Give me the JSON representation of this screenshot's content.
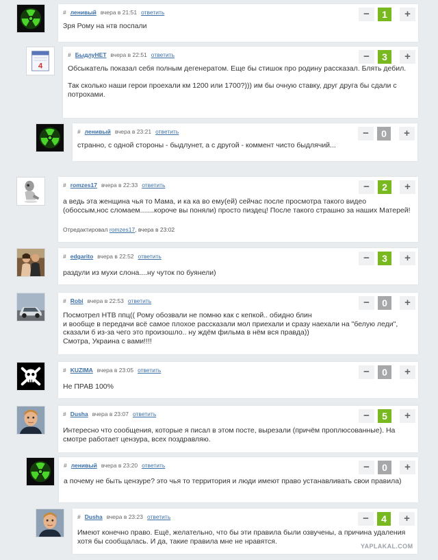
{
  "comments": [
    {
      "user": "ленивый",
      "time": "вчера в 21:51",
      "reply": "ответить",
      "score": "1",
      "text": "Зря Рому на нтв поспали",
      "avatar": "radiation-icon"
    },
    {
      "user": "БыдлуНЕТ",
      "time": "вчера в 22:51",
      "reply": "ответить",
      "score": "3",
      "text": "Обсыкатель показал себя полным дегенератом. Еще бы стишок про родину рассказал. Блять дебил.\n\nТак сколько наши герои проехали км 1200 или 1700?))) им бы очную ставку, друг друга бы сдали с потрохами.",
      "avatar": "calendar-icon"
    },
    {
      "user": "ленивый",
      "time": "вчера в 23:21",
      "reply": "ответить",
      "score": "0",
      "text": "странно, с одной стороны - быдлунет, а с другой - коммент чисто быдлячий...",
      "avatar": "radiation-icon"
    },
    {
      "user": "romzes17",
      "time": "вчера в 22:33",
      "reply": "ответить",
      "score": "2",
      "text": "а ведь эта женщина чья то Мама, и ка ка во ему(ей) сейчас после просмотра такого видео (обоссым,нос сломаем.......короче вы поняли) просто пиздец! После такого страшно за наших Матерей!",
      "edited_label": "Отредактировал",
      "edited_user": "romzes17",
      "edited_time": ", вчера в 23:02",
      "avatar": "figure-icon"
    },
    {
      "user": "edgarito",
      "time": "вчера в 22:52",
      "reply": "ответить",
      "score": "3",
      "text": "раздули из мухи слона....ну чуток по буянели)",
      "avatar": "photo-people-icon"
    },
    {
      "user": "Robi",
      "time": "вчера в 22:53",
      "reply": "ответить",
      "score": "0",
      "text": "Посмотрел НТВ ппц(( Рому обозвали не помню как с кепкой.. обидно блин\nи вообще в передачи всё самое плохое рассказали мол приехали и сразу наехали на \"белую леди\", сказали б из-за чего это произошло.. ну ждём фильма в нём вся правда))\nСмотра, Украина с вами!!!!",
      "avatar": "car-icon"
    },
    {
      "user": "KUZIMA",
      "time": "вчера в 23:05",
      "reply": "ответить",
      "score": "0",
      "text": "Не ПРАВ 100%",
      "avatar": "skull-icon"
    },
    {
      "user": "Dusha",
      "time": "вчера в 23:07",
      "reply": "ответить",
      "score": "5",
      "text": "Интересно что сообщения, которые я писал в этом посте, вырезали (причём проплюсованные). На смотре работает цензура, всех поздравляю.",
      "avatar": "face-icon"
    },
    {
      "user": "ленивый",
      "time": "вчера в 23:20",
      "reply": "ответить",
      "score": "0",
      "text": "а почему не быть цензуре? это чья то территория и люди имеют право устанавливать свои правила)",
      "avatar": "radiation-icon"
    },
    {
      "user": "Dusha",
      "time": "вчера в 23:23",
      "reply": "ответить",
      "score": "4",
      "text": "Имеют конечно право. Ещё, желательно, что бы эти правила были озвучены, а причина удаления хотя бы сообщалась. И да, такие правила мне не нравятся.",
      "avatar": "face-icon"
    }
  ],
  "vote": {
    "minus": "−",
    "plus": "+"
  },
  "hash": "#",
  "watermark": "YAPLAKAL.COM",
  "colors": {
    "positive": "#78b91f",
    "neutral": "#a6a8aa",
    "link": "#3a6fa8",
    "background": "#e9ecef"
  }
}
